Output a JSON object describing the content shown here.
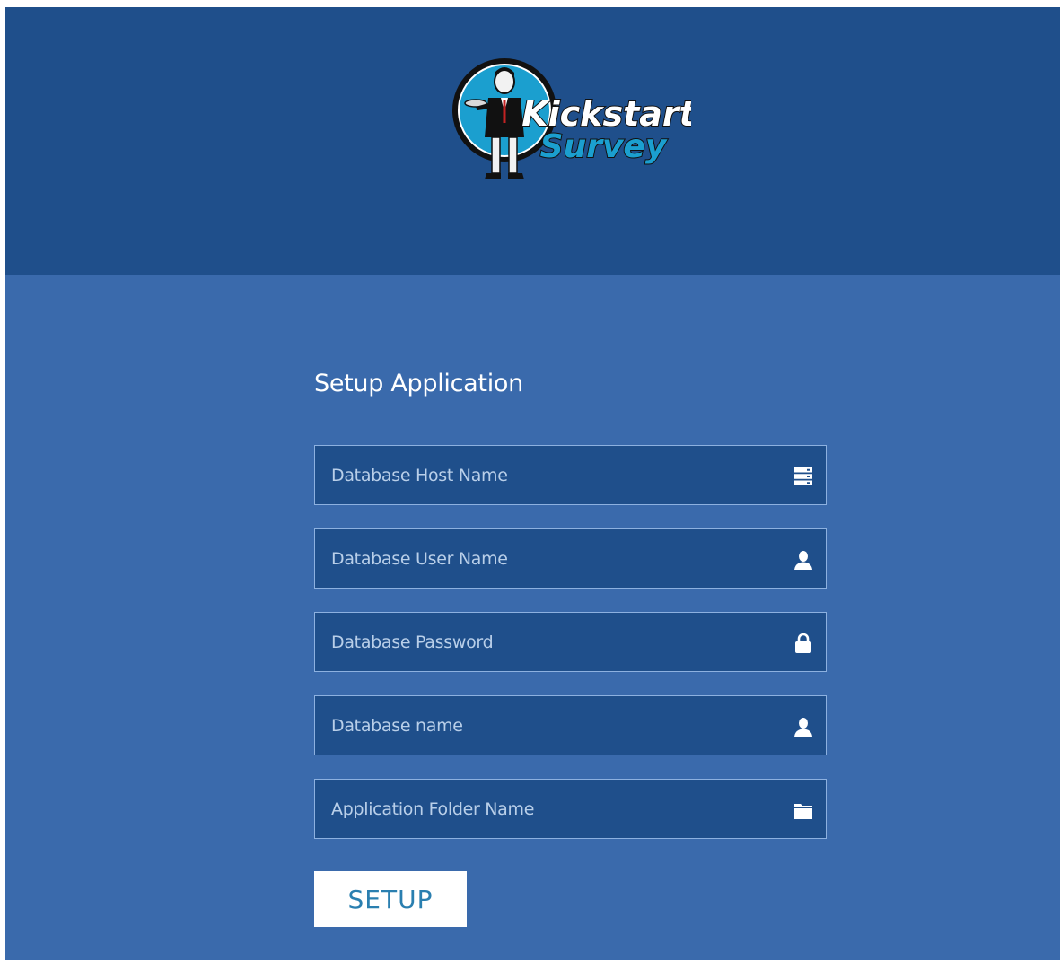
{
  "header": {
    "logo": {
      "line1": "Kickstart",
      "line2": "Survey"
    }
  },
  "form": {
    "title": "Setup Application",
    "fields": [
      {
        "placeholder": "Database Host Name",
        "value": "",
        "icon": "server-icon"
      },
      {
        "placeholder": "Database User Name",
        "value": "",
        "icon": "user-icon"
      },
      {
        "placeholder": "Database Password",
        "value": "",
        "icon": "lock-icon"
      },
      {
        "placeholder": "Database name",
        "value": "",
        "icon": "user-icon"
      },
      {
        "placeholder": "Application Folder Name",
        "value": "",
        "icon": "folder-icon"
      }
    ],
    "submit_label": "SETUP"
  },
  "colors": {
    "header_bg": "#1f4f8b",
    "main_bg": "#3a6aac",
    "field_bg": "#1f4f8b",
    "field_border": "#8db1e0",
    "button_text": "#2a7fb0"
  }
}
